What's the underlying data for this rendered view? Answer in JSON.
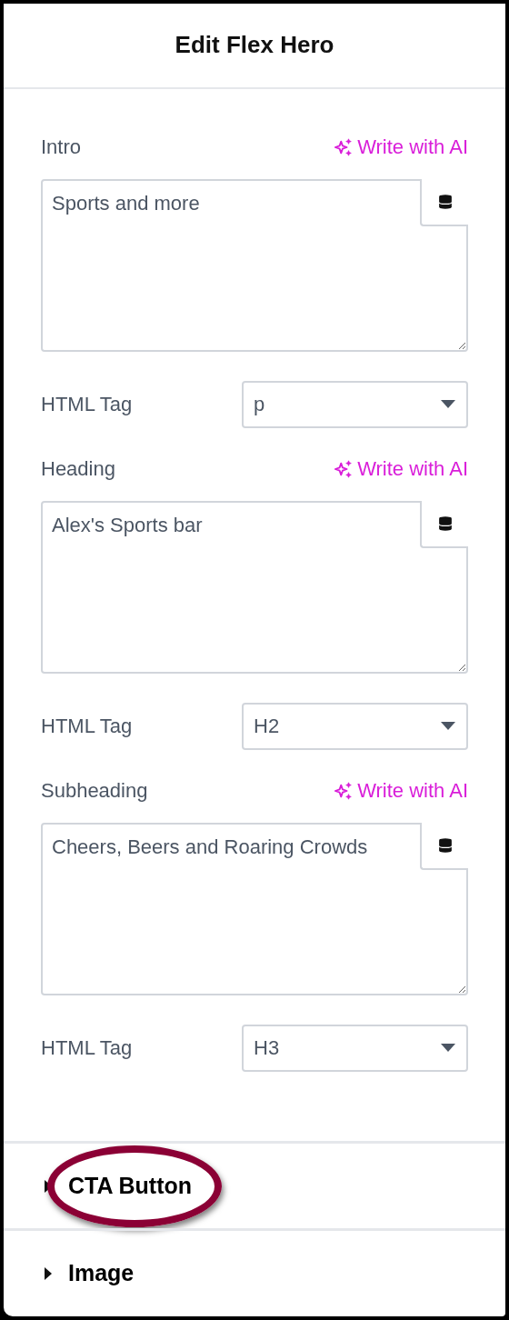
{
  "title": "Edit Flex Hero",
  "fields": [
    {
      "label": "Intro",
      "ai_action": "Write with AI",
      "value": "Sports and more",
      "tag_label": "HTML Tag",
      "tag_value": "p"
    },
    {
      "label": "Heading",
      "ai_action": "Write with AI",
      "value": "Alex's Sports bar",
      "tag_label": "HTML Tag",
      "tag_value": "H2"
    },
    {
      "label": "Subheading",
      "ai_action": "Write with AI",
      "value": "Cheers, Beers and Roaring Crowds",
      "tag_label": "HTML Tag",
      "tag_value": "H3"
    }
  ],
  "sections": [
    {
      "label": "CTA Button",
      "expanded": false,
      "highlighted": true
    },
    {
      "label": "Image",
      "expanded": false,
      "highlighted": false
    }
  ]
}
